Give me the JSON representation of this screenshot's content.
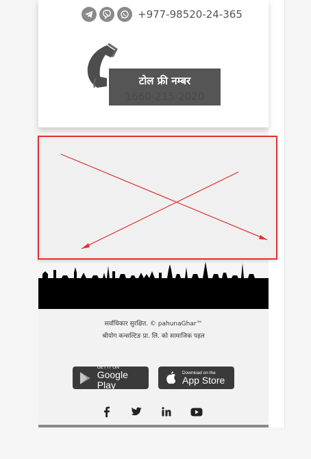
{
  "contact": {
    "phone": "+977-98520-24-365",
    "messaging_apps": [
      "telegram-icon",
      "viber-icon",
      "whatsapp-icon"
    ]
  },
  "tollfree": {
    "label": "टोल फ्री नम्बर",
    "number": "1660-215-2020"
  },
  "footer": {
    "copyright": "सर्वाधिकार सुरक्षित. © pahunaGhar™",
    "credit": "श्रीयोग कन्सल्टिङ प्रा. लि. को सामाजिक पहल",
    "google_play": {
      "small": "GET IT ON",
      "big": "Google Play"
    },
    "app_store": {
      "small": "Download on the",
      "big": "App Store"
    },
    "social": [
      "facebook-icon",
      "twitter-icon",
      "linkedin-icon",
      "youtube-icon"
    ]
  },
  "colors": {
    "card_bg": "#ffffff",
    "tollfree_bg": "#555555",
    "placeholder_border": "#e03030",
    "footer_bg": "#f2f2f2",
    "store_bg": "#3a3a3a"
  }
}
